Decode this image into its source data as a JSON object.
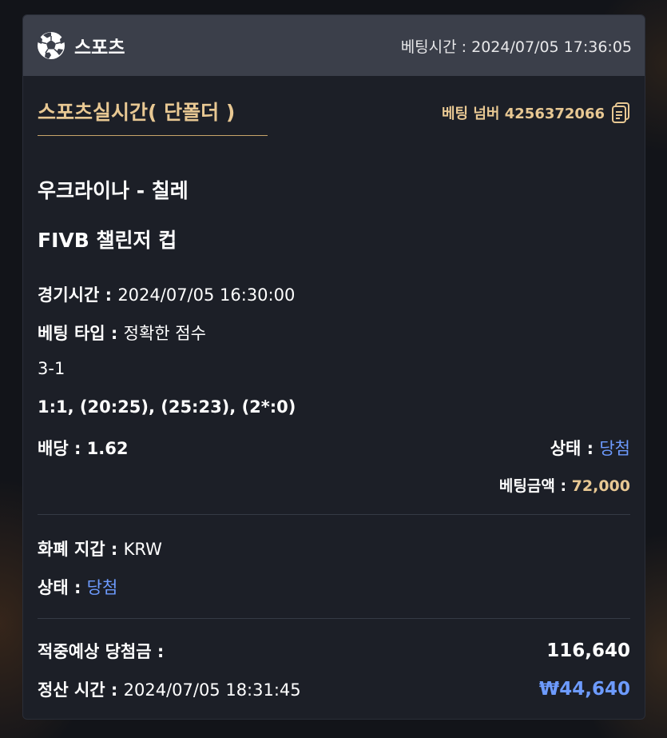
{
  "header": {
    "title": "스포츠",
    "bet_time_label": "베팅시간 : ",
    "bet_time_value": "2024/07/05 17:36:05"
  },
  "ticket": {
    "tab_title": "스포츠실시간( 단폴더 )",
    "bet_number_label": "베팅 넘버 ",
    "bet_number_value": "4256372066",
    "match_name": "우크라이나 - 칠레",
    "league_name": "FIVB 챌린저 컵",
    "game_time_label": "경기시간 : ",
    "game_time_value": "2024/07/05 16:30:00",
    "bet_type_label": "베팅 타입 : ",
    "bet_type_value": "정확한 점수",
    "pick": "3-1",
    "score_detail": "1:1, (20:25), (25:23), (2*:0)",
    "odds_label": "배당 : ",
    "odds_value": "1.62",
    "status_label": "상태 : ",
    "status_value": "당첨",
    "bet_amount_label": "베팅금액 : ",
    "bet_amount_value": "72,000"
  },
  "wallet": {
    "currency_label": "화폐 지갑 : ",
    "currency_value": "KRW",
    "status_label": "상태 : ",
    "status_value": "당첨"
  },
  "payout": {
    "expected_label": "적중예상 당첨금 : ",
    "expected_value": "116,640",
    "settle_label": "정산 시간 : ",
    "settle_value": "2024/07/05 18:31:45",
    "won_value": "₩44,640"
  },
  "colors": {
    "accent_gold": "#e8c893",
    "status_blue": "#6d9bff",
    "card_bg": "#1c1f27",
    "header_bg": "#3b3f4a"
  },
  "icons": {
    "sport": "soccer-ball-icon",
    "copy": "copy-icon"
  }
}
